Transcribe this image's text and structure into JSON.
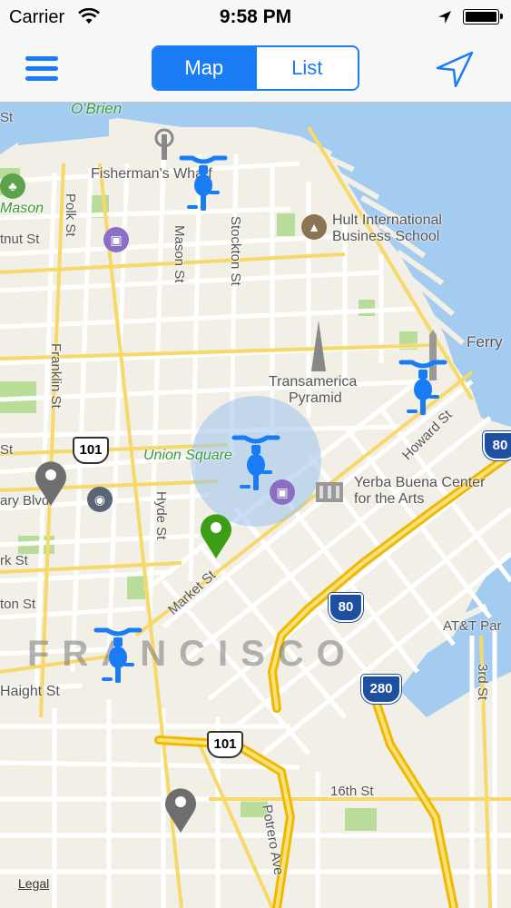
{
  "status_bar": {
    "carrier": "Carrier",
    "time": "9:58 PM"
  },
  "nav": {
    "tabs": [
      {
        "label": "Map",
        "active": true
      },
      {
        "label": "List",
        "active": false
      }
    ]
  },
  "map": {
    "labels": {
      "obrien": "O'Brien",
      "mason_park": "Mason",
      "fishermans_wharf": "Fisherman's Wharf",
      "hult_line1": "Hult International",
      "hult_line2": "Business School",
      "mason_st": "Mason St",
      "stockton_st": "Stockton St",
      "polk_st": "Polk St",
      "chestnut_st": "tnut St",
      "franklin_st": "Franklin St",
      "ferry": "Ferry",
      "transamerica_line1": "Transamerica",
      "transamerica_line2": "Pyramid",
      "union_square": "Union Square",
      "howard_st": "Howard St",
      "yerba_line1": "Yerba Buena Center",
      "yerba_line2": "for the Arts",
      "geary_blvd": "ary Blvd",
      "hyde_st": "Hyde St",
      "market_st": "Market St",
      "pine_st": "St",
      "fulton_st": "rk St",
      "grove_st": "ton St",
      "haight_st": "Haight St",
      "city_name": "FRANCISCO",
      "att_park": "AT&T Par",
      "third_st": "3rd St",
      "sixteenth_st": "16th St",
      "potrero_ave": "Potrero Ave",
      "c_st": "St"
    },
    "shields": {
      "us101_top": "101",
      "i80_right": "80",
      "i80_center": "80",
      "i280": "280",
      "us101_bottom": "101"
    },
    "legal": "Legal",
    "colors": {
      "accent": "#1a7cf5",
      "water": "#a3ccf0",
      "land": "#f2efe6",
      "park": "#b9dc9b",
      "highway": "#f3c41b",
      "pin_grey": "#6e6e6e",
      "pin_green": "#3d9e16"
    }
  }
}
